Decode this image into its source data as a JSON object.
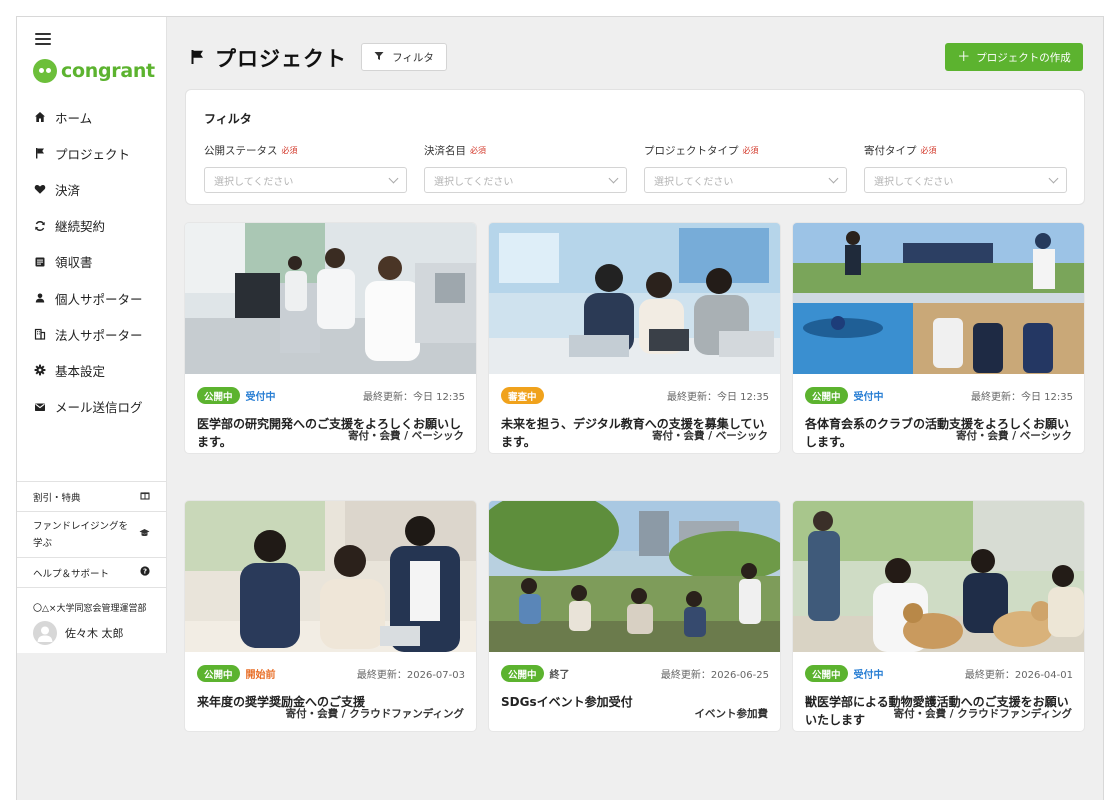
{
  "sidebar": {
    "logo_text": "congrant",
    "nav": [
      {
        "label": "ホーム",
        "icon": "home-icon"
      },
      {
        "label": "プロジェクト",
        "icon": "flag-icon"
      },
      {
        "label": "決済",
        "icon": "heart-icon"
      },
      {
        "label": "継続契約",
        "icon": "refresh-icon"
      },
      {
        "label": "領収書",
        "icon": "receipt-icon"
      },
      {
        "label": "個人サポーター",
        "icon": "person-icon"
      },
      {
        "label": "法人サポーター",
        "icon": "building-icon"
      },
      {
        "label": "基本設定",
        "icon": "gear-icon"
      },
      {
        "label": "メール送信ログ",
        "icon": "mail-icon"
      }
    ],
    "links": [
      {
        "label": "割引・特典",
        "icon": "gift-icon"
      },
      {
        "label": "ファンドレイジングを学ぶ",
        "icon": "graduation-cap-icon"
      },
      {
        "label": "ヘルプ＆サポート",
        "icon": "help-icon"
      }
    ],
    "org_name": "〇△×大学同窓会管理運営部",
    "user_name": "佐々木 太郎"
  },
  "header": {
    "title": "プロジェクト",
    "filter_button": "フィルタ",
    "create_button": "プロジェクトの作成"
  },
  "filter_panel": {
    "heading": "フィルタ",
    "required_label": "必須",
    "fields": [
      {
        "label": "公開ステータス",
        "placeholder": "選択してください"
      },
      {
        "label": "決済名目",
        "placeholder": "選択してください"
      },
      {
        "label": "プロジェクトタイプ",
        "placeholder": "選択してください"
      },
      {
        "label": "寄付タイプ",
        "placeholder": "選択してください"
      }
    ]
  },
  "colors": {
    "accent": "#5cb32f",
    "badge_public": "#5cb32f",
    "badge_review": "#f0a21c",
    "status_accepting": "#2a7fd4",
    "status_before": "#e8702a",
    "status_ended": "#555555"
  },
  "cards": [
    {
      "badge": "公開中",
      "badge_color": "#5cb32f",
      "status": "受付中",
      "status_color": "#2a7fd4",
      "updated": "最終更新：今日 12:35",
      "title": "医学部の研究開発へのご支援をよろしくお願いします。",
      "footer": "寄付・会費 / ベーシック",
      "image": "laboratory-photo"
    },
    {
      "badge": "審査中",
      "badge_color": "#f0a21c",
      "status": "",
      "status_color": "#2a7fd4",
      "updated": "最終更新：今日 12:35",
      "title": "未来を担う、デジタル教育への支援を募集しています。",
      "footer": "寄付・会費 / ベーシック",
      "image": "digital-classroom-photo"
    },
    {
      "badge": "公開中",
      "badge_color": "#5cb32f",
      "status": "受付中",
      "status_color": "#2a7fd4",
      "updated": "最終更新：今日 12:35",
      "title": "各体育会系のクラブの活動支援をよろしくお願いします。",
      "footer": "寄付・会費 / ベーシック",
      "image": "sports-collage-photo"
    },
    {
      "badge": "公開中",
      "badge_color": "#5cb32f",
      "status": "開始前",
      "status_color": "#e8702a",
      "updated": "最終更新：2026-07-03",
      "title": "来年度の奨学奨励金へのご支援",
      "footer": "寄付・会費 / クラウドファンディング",
      "image": "students-study-photo"
    },
    {
      "badge": "公開中",
      "badge_color": "#5cb32f",
      "status": "終了",
      "status_color": "#555555",
      "updated": "最終更新：2026-06-25",
      "title": "SDGsイベント参加受付",
      "footer": "イベント参加費",
      "image": "sdgs-event-photo"
    },
    {
      "badge": "公開中",
      "badge_color": "#5cb32f",
      "status": "受付中",
      "status_color": "#2a7fd4",
      "updated": "最終更新：2026-04-01",
      "title": "獣医学部による動物愛護活動へのご支援をお願いいたします",
      "footer": "寄付・会費 / クラウドファンディング",
      "image": "veterinary-dogs-photo"
    }
  ]
}
